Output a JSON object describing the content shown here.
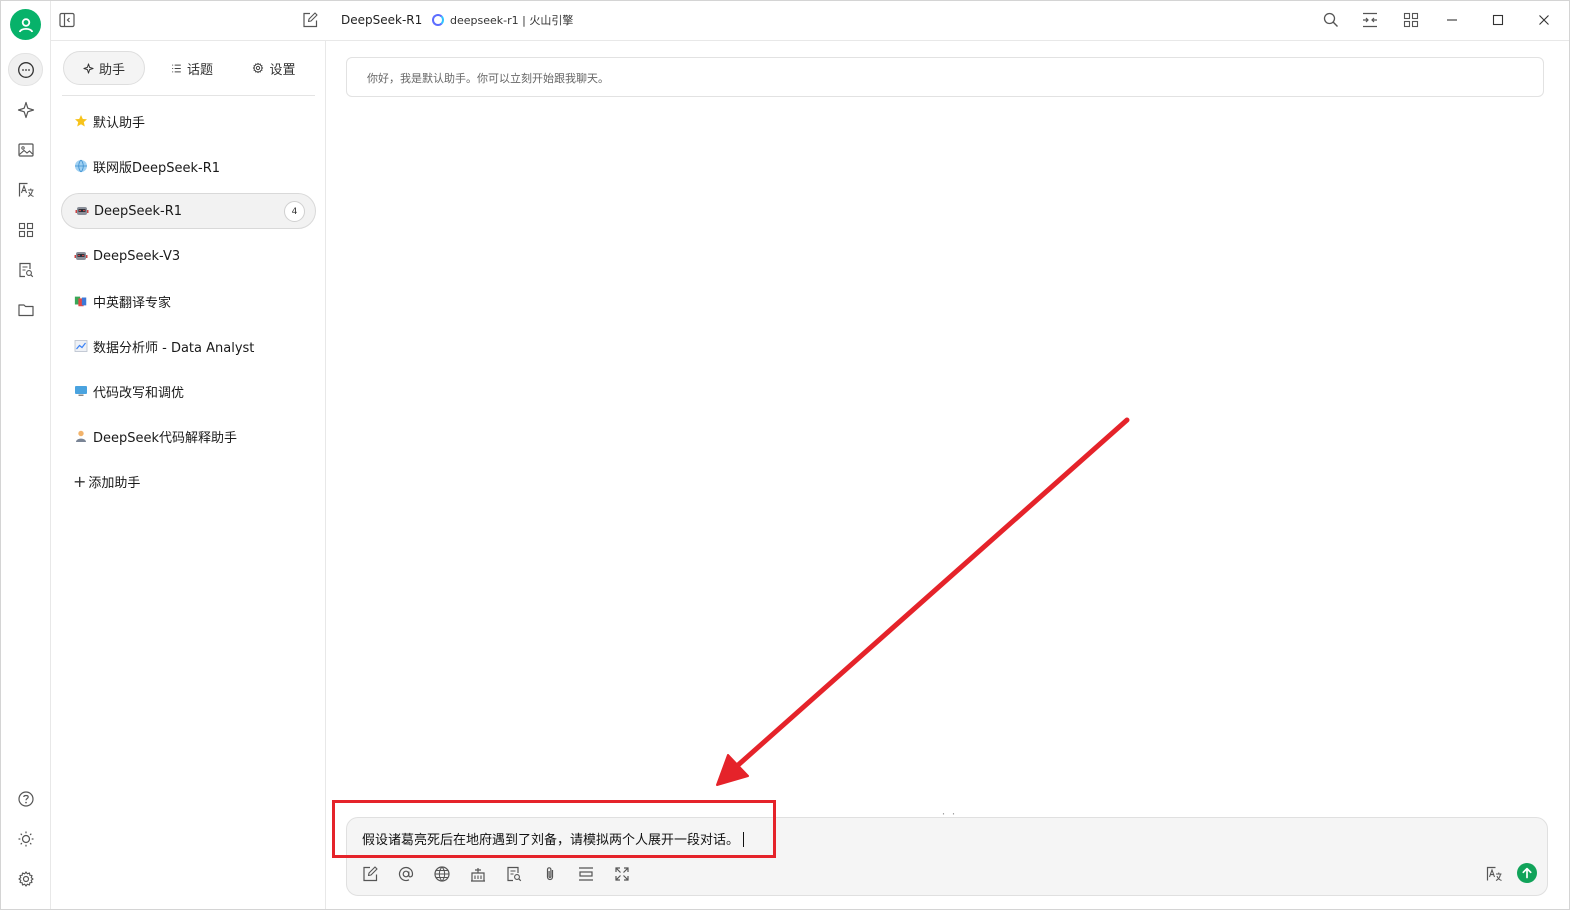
{
  "window": {
    "model_title": "DeepSeek-R1",
    "provider_label": "deepseek-r1 | 火山引擎"
  },
  "rail": {
    "items": [
      {
        "name": "chat-icon",
        "active": true
      },
      {
        "name": "sparkle-icon"
      },
      {
        "name": "image-icon"
      },
      {
        "name": "translate-icon"
      },
      {
        "name": "apps-grid-icon"
      },
      {
        "name": "document-search-icon"
      },
      {
        "name": "folder-icon"
      }
    ],
    "bottom": [
      {
        "name": "help-icon"
      },
      {
        "name": "sun-icon"
      },
      {
        "name": "gear-icon"
      }
    ]
  },
  "tabs": [
    {
      "label": "助手",
      "icon": "sparkle-icon",
      "active": true
    },
    {
      "label": "话题",
      "icon": "list-icon"
    },
    {
      "label": "设置",
      "icon": "gear-icon"
    }
  ],
  "assistants": [
    {
      "label": "默认助手",
      "icon": "star-icon"
    },
    {
      "label": "联网版DeepSeek-R1",
      "icon": "globe-icon"
    },
    {
      "label": "DeepSeek-R1",
      "icon": "robot-icon",
      "active": true,
      "count": "4"
    },
    {
      "label": "DeepSeek-V3",
      "icon": "robot-icon"
    },
    {
      "label": "中英翻译专家",
      "icon": "books-icon"
    },
    {
      "label": "数据分析师 - Data Analyst",
      "icon": "chart-icon"
    },
    {
      "label": "代码改写和调优",
      "icon": "computer-icon"
    },
    {
      "label": "DeepSeek代码解释助手",
      "icon": "person-icon"
    }
  ],
  "add_assistant_label": "添加助手",
  "chat": {
    "greeting": "你好，我是默认助手。你可以立刻开始跟我聊天。",
    "input_value": "假设诸葛亮死后在地府遇到了刘备，请模拟两个人展开一段对话。",
    "resize_grip": "⋮⋮"
  },
  "colors": {
    "accent": "#07b26a",
    "send": "#11a35a",
    "annotation": "#e5232a"
  }
}
